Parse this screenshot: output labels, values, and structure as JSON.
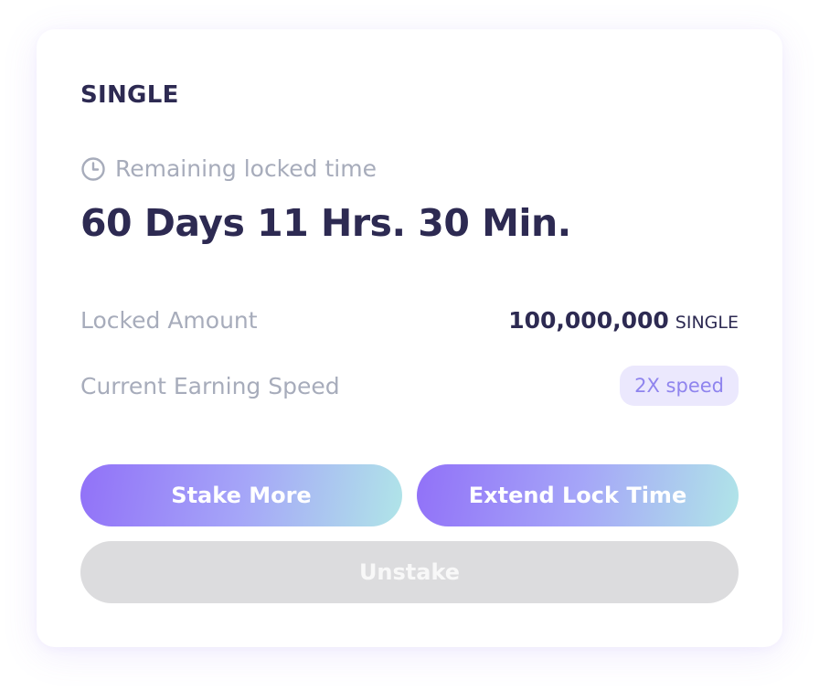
{
  "card": {
    "token_name": "SINGLE",
    "remaining": {
      "icon": "clock-icon",
      "label": "Remaining locked time",
      "value": "60 Days 11 Hrs. 30 Min."
    },
    "locked_amount": {
      "label": "Locked Amount",
      "value": "100,000,000",
      "unit": "SINGLE"
    },
    "earning_speed": {
      "label": "Current Earning Speed",
      "badge": "2X speed"
    },
    "buttons": {
      "stake_more": "Stake More",
      "extend_lock": "Extend Lock Time",
      "unstake": "Unstake",
      "unstake_disabled": true
    }
  },
  "colors": {
    "title": "#2d2a52",
    "muted": "#a7acbb",
    "badge_bg": "#ebe8fd",
    "badge_text": "#8f84ee",
    "gradient_start": "#9171f8",
    "gradient_end": "#b0e5e8",
    "disabled_bg": "#dcdcde"
  }
}
